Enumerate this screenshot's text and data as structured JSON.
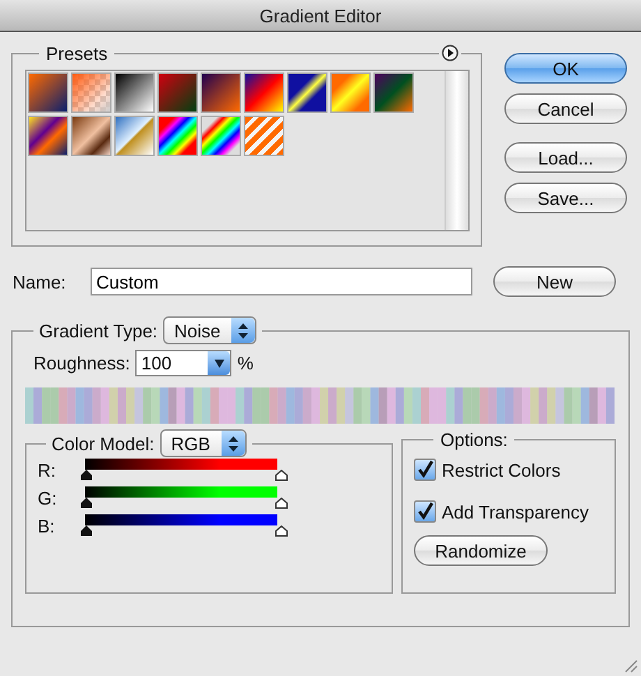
{
  "window": {
    "title": "Gradient Editor"
  },
  "presets": {
    "title": "Presets"
  },
  "buttons": [
    {
      "label": "OK",
      "default": true
    },
    {
      "label": "Cancel",
      "default": false
    },
    {
      "label": "Load...",
      "default": false
    },
    {
      "label": "Save...",
      "default": false
    }
  ],
  "name": {
    "label": "Name:",
    "value": "Custom",
    "button": "New"
  },
  "gradient_type": {
    "label": "Gradient Type:",
    "value": "Noise"
  },
  "roughness": {
    "label": "Roughness:",
    "value": "100",
    "unit": "%"
  },
  "color_model": {
    "label": "Color Model:",
    "value": "RGB"
  },
  "channels": [
    {
      "name": "R:",
      "color": "#ff0000"
    },
    {
      "name": "G:",
      "color": "#00ff00"
    },
    {
      "name": "B:",
      "color": "#0000ff"
    }
  ],
  "options": {
    "title": "Options:",
    "items": [
      {
        "label": "Restrict Colors",
        "checked": true
      },
      {
        "label": "Add Transparency",
        "checked": true
      }
    ],
    "button": "Randomize"
  }
}
